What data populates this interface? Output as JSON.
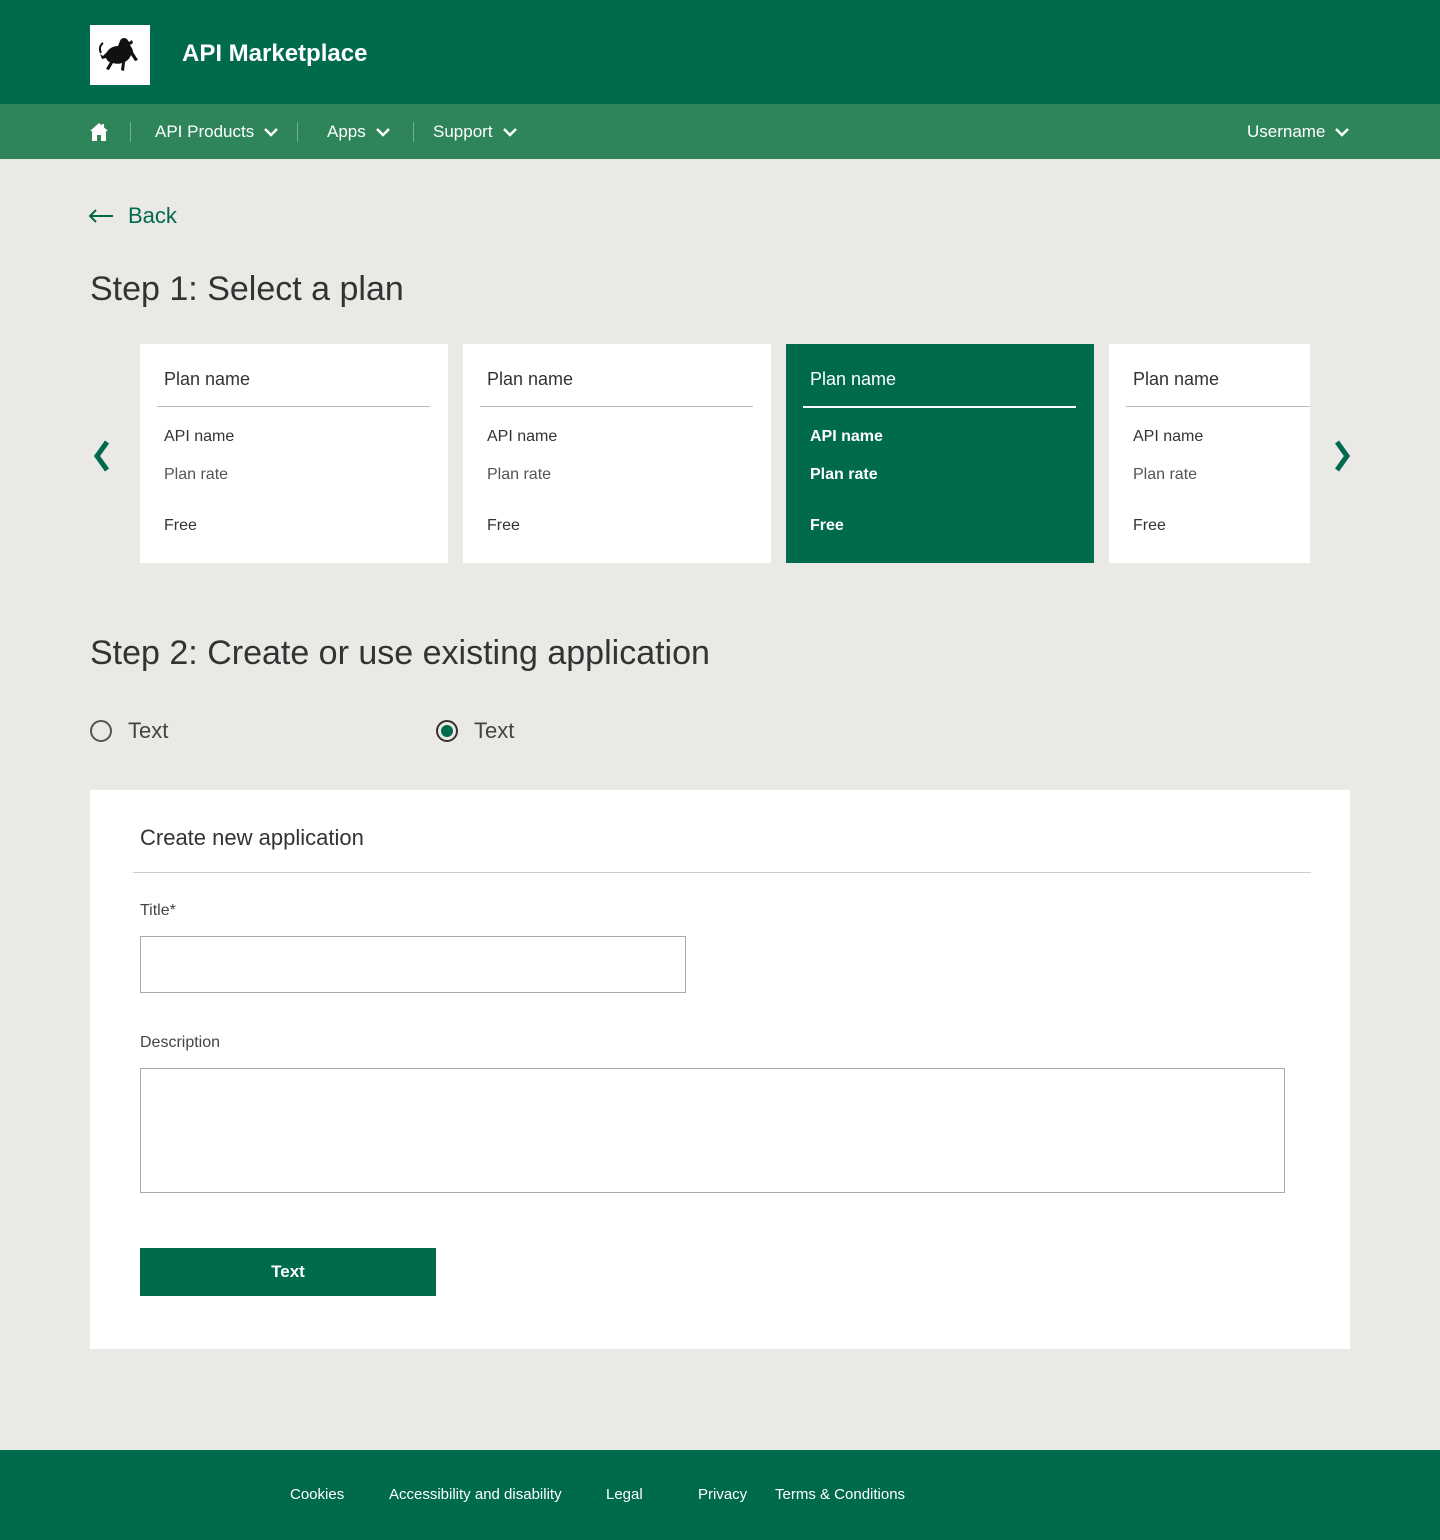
{
  "header": {
    "app_title": "API Marketplace",
    "logo_icon": "black-horse-logo"
  },
  "nav": {
    "home_icon": "home-icon",
    "items": [
      {
        "label": "API Products"
      },
      {
        "label": "Apps"
      },
      {
        "label": "Support"
      }
    ],
    "user": {
      "label": "Username"
    }
  },
  "back": {
    "label": "Back"
  },
  "step1": {
    "title": "Step 1: Select a plan",
    "plans": [
      {
        "name": "Plan name",
        "api": "API name",
        "rate": "Plan rate",
        "price": "Free",
        "selected": false
      },
      {
        "name": "Plan name",
        "api": "API name",
        "rate": "Plan rate",
        "price": "Free",
        "selected": false
      },
      {
        "name": "Plan name",
        "api": "API name",
        "rate": "Plan rate",
        "price": "Free",
        "selected": true
      },
      {
        "name": "Plan name",
        "api": "API name",
        "rate": "Plan rate",
        "price": "Free",
        "selected": false
      }
    ]
  },
  "step2": {
    "title": "Step 2: Create or use existing application",
    "options": [
      {
        "label": "Text",
        "checked": false
      },
      {
        "label": "Text",
        "checked": true
      }
    ]
  },
  "form": {
    "title": "Create new application",
    "title_label": "Title*",
    "title_value": "",
    "description_label": "Description",
    "description_value": "",
    "submit_label": "Text"
  },
  "footer": {
    "links": [
      "Cookies",
      "Accessibility and disability",
      "Legal",
      "Privacy",
      "Terms & Conditions"
    ]
  },
  "colors": {
    "brand": "#006a4d",
    "nav": "#2e855a",
    "background": "#ebe9e5"
  }
}
